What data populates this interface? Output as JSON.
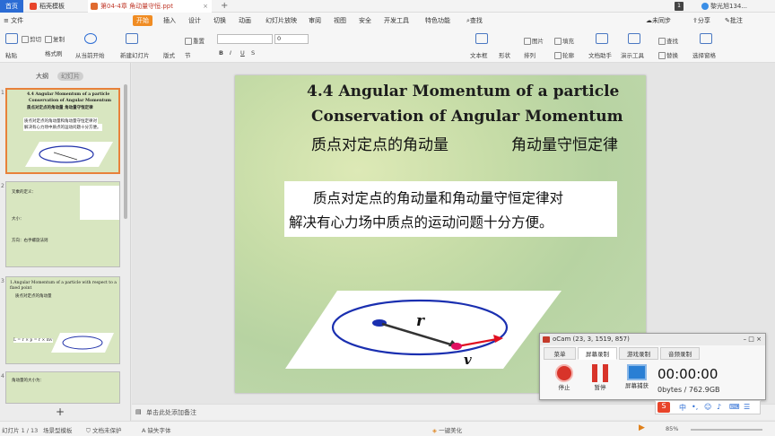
{
  "titlebar": {
    "home": "首页",
    "templates_tab": "稻壳模板",
    "doc_tab": "第04-4章 角动量守恒.ppt",
    "win_num": "1",
    "user": "黎光旭134..."
  },
  "menu": {
    "file": "文件",
    "items": [
      "开始",
      "插入",
      "设计",
      "切换",
      "动画",
      "幻灯片放映",
      "审阅",
      "视图",
      "安全",
      "开发工具",
      "特色功能"
    ],
    "search": "查找",
    "sync": "未同步",
    "share": "分享",
    "batch": "批注"
  },
  "toolbar": {
    "paste": "粘贴",
    "cut": "剪切",
    "copy": "复制",
    "format_painter": "格式刷",
    "play_from": "从当前开始",
    "new_slide": "新建幻灯片",
    "layout": "版式",
    "section": "节",
    "reset": "重置",
    "font_size": "0",
    "textbox": "文本框",
    "shape": "形状",
    "arrange": "排列",
    "picture": "图片",
    "fill": "填充",
    "outline": "轮廓",
    "text_assist": "文档助手",
    "presentation_tools": "演示工具",
    "find": "查找",
    "replace": "替换",
    "select_pane": "选择窗格"
  },
  "panel": {
    "outline_tab": "大纲",
    "slides_tab": "幻灯片",
    "thumbs": [
      {
        "num": "1",
        "line1": "4.4 Angular Momentum of a particle",
        "line2": "Conservation of Angular Momentum",
        "line3": "质点对定点的角动量    角动量守恒定律",
        "line4": "质点对定点的角动量和角动量守恒定律对",
        "line5": "解决有心力场中质点的运动问题十分方便。"
      },
      {
        "num": "2",
        "line1": "叉乘的定义：",
        "line2": "大小：",
        "line3": "方向：右手螺旋法则"
      },
      {
        "num": "3",
        "line1": "1.Angular Momentum of a particle with respect to a",
        "line2": "fixed point",
        "line3": "质点对定点的角动量",
        "line4": "L = r × p = r × mv"
      },
      {
        "num": "4",
        "line1": "角动量的大小为："
      }
    ]
  },
  "slide": {
    "title_en_1": "4.4 Angular Momentum of a particle",
    "title_en_2": "Conservation of Angular Momentum",
    "title_zh_1": "质点对定点的角动量",
    "title_zh_2": "角动量守恒定律",
    "body_1": "质点对定点的角动量和角动量守恒定律对",
    "body_2": "解决有心力场中质点的运动问题十分方便。",
    "label_r": "r",
    "label_v": "v"
  },
  "notes": {
    "placeholder": "单击此处添加备注"
  },
  "status": {
    "slide_count": "幻灯片 1 / 13",
    "template": "场景型模板",
    "protect": "文档未保护",
    "font_missing": "缺失字体",
    "beautify": "一键美化",
    "zoom": "85%"
  },
  "ocam": {
    "title": "oCam (23, 3, 1519, 857)",
    "tabs": [
      "菜单",
      "屏幕录制",
      "游戏录制",
      "音频录制"
    ],
    "stop": "停止",
    "pause": "暂停",
    "capture": "屏幕捕获",
    "time": "00:00:00",
    "size": "0bytes / 762.9GB"
  },
  "ime": {
    "lang": "中"
  }
}
